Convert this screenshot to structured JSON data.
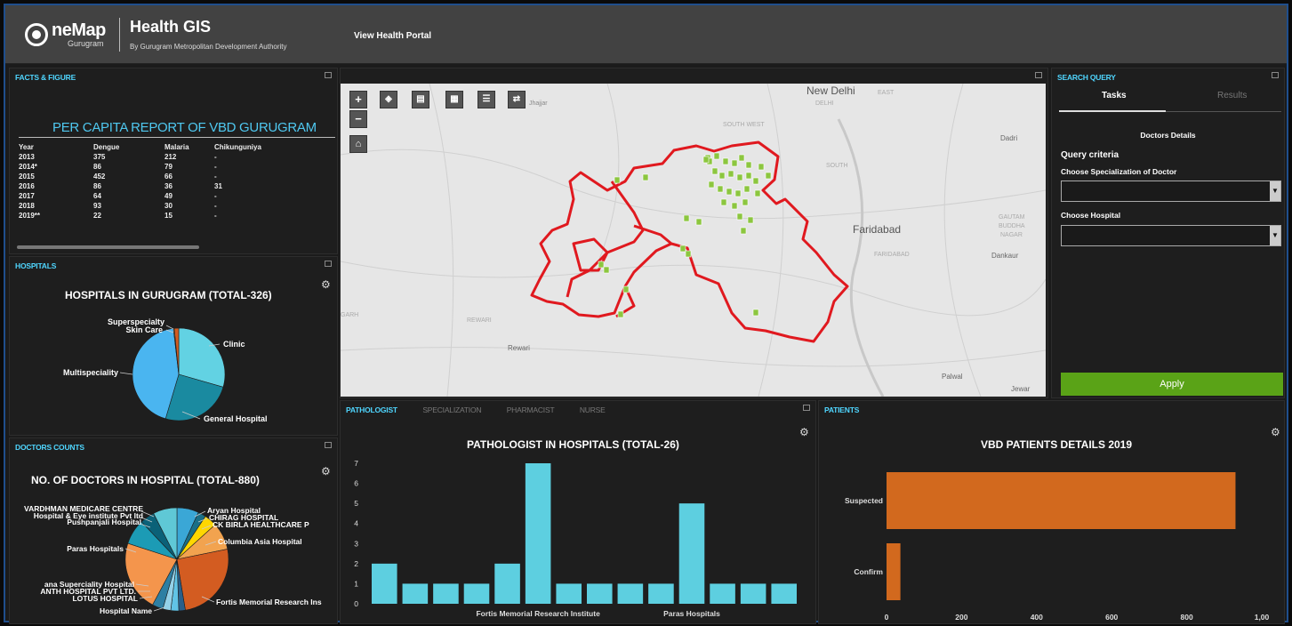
{
  "header": {
    "logo_name": "neMap",
    "logo_sub": "Gurugram",
    "title": "Health GIS",
    "subtitle": "By Gurugram Metropolitan Development Authority",
    "portal_link": "View Health Portal"
  },
  "facts": {
    "panel_title": "FACTS & FIGURE",
    "heading": "PER CAPITA REPORT OF VBD GURUGRAM",
    "columns": [
      "Year",
      "Dengue",
      "Malaria",
      "Chikunguniya"
    ],
    "rows": [
      [
        "2013",
        "375",
        "212",
        "-"
      ],
      [
        "2014*",
        "86",
        "79",
        "-"
      ],
      [
        "2015",
        "452",
        "66",
        "-"
      ],
      [
        "2016",
        "86",
        "36",
        "31"
      ],
      [
        "2017",
        "64",
        "49",
        "-"
      ],
      [
        "2018",
        "93",
        "30",
        "-"
      ],
      [
        "2019**",
        "22",
        "15",
        "-"
      ]
    ]
  },
  "hospitals": {
    "panel_title": "HOSPITALS",
    "chart_title": "HOSPITALS IN GURUGRAM (TOTAL-326)",
    "labels": {
      "superspecialty": "Superspecialty",
      "skin_care": "Skin Care",
      "clinic": "Clinic",
      "multispeciality": "Multispeciality",
      "general_hospital": "General Hospital"
    }
  },
  "doctors": {
    "panel_title": "DOCTORS COUNTS",
    "chart_title": "NO. OF DOCTORS IN HOSPITAL (TOTAL-880)",
    "labels": {
      "vardhman": "VARDHMAN MEDICARE CENTRE",
      "eye": "Hospital & Eye institute Pvt ltd",
      "pushpanjali": "Pushpanjali Hospital",
      "paras": "Paras Hospitals",
      "rana": "ana Superciality Hospital",
      "anth": "ANTH HOSPITAL PVT LTD.",
      "lotus": "LOTUS HOSPITAL",
      "hospital_name": "Hospital Name",
      "aryan": "Aryan Hospital",
      "chirag": "CHIRAG HOSPITAL",
      "ckbirla": "CK BIRLA HEALTHCARE P",
      "columbia": "Columbia Asia Hospital",
      "fortis": "Fortis Memorial Research Ins"
    }
  },
  "map": {
    "place_labels": {
      "new_delhi": "New Delhi",
      "east": "EAST",
      "delhi": "DELHI",
      "southwest": "SOUTH WEST",
      "south": "SOUTH",
      "dadri": "Dadri",
      "faridabad": "Faridabad",
      "faridabad_small": "FARIDABAD",
      "gautam": "GAUTAM",
      "buddha": "BUDDHA",
      "nagar": "NAGAR",
      "dankaur": "Dankaur",
      "rewari_caps": "REWARI",
      "rewari": "Rewari",
      "garh": "GARH",
      "palwal": "Palwal",
      "jewar": "Jewar",
      "jhajjar": "Jhajjar"
    },
    "zoom_in": "+",
    "zoom_out": "−"
  },
  "search": {
    "panel_title": "SEARCH QUERY",
    "tab_tasks": "Tasks",
    "tab_results": "Results",
    "section": "Doctors Details",
    "criteria": "Query criteria",
    "label_specialization": "Choose Specialization of Doctor",
    "label_hospital": "Choose Hospital",
    "specialization_value": "",
    "hospital_value": "",
    "apply": "Apply"
  },
  "staff": {
    "tabs": [
      "PATHOLOGIST",
      "SPECIALIZATION",
      "PHARMACIST",
      "NURSE"
    ],
    "chart_title": "PATHOLOGIST IN HOSPITALS (TOTAL-26)"
  },
  "patients": {
    "panel_title": "PATIENTS",
    "chart_title": "VBD PATIENTS DETAILS 2019"
  },
  "colors": {
    "accent": "#4fd6ff",
    "apply_green": "#5aa317",
    "bar_cyan": "#5dcfe0",
    "bar_orange": "#d2691e",
    "boundary_red": "#e0191f",
    "hospital_green": "#8cc63f"
  },
  "chart_data": [
    {
      "type": "pie",
      "categories": [
        "Clinic",
        "General Hospital",
        "Multispeciality",
        "Skin Care",
        "Superspecialty"
      ],
      "values": [
        96,
        82,
        142,
        1,
        5
      ],
      "title": "HOSPITALS IN GURUGRAM (TOTAL-326)"
    },
    {
      "type": "pie",
      "categories": [
        "Aryan Hospital",
        "CHIRAG HOSPITAL",
        "CK BIRLA HEALTHCARE P",
        "Columbia Asia Hospital",
        "Fortis Memorial Research Ins",
        "Hospital Name",
        "LOTUS HOSPITAL",
        "ANTH HOSPITAL PVT LTD.",
        "ana Superciality Hospital",
        "Paras Hospitals",
        "Pushpanjali Hospital",
        "Hospital & Eye institute Pvt ltd",
        "VARDHMAN MEDICARE CENTRE"
      ],
      "values": [
        60,
        22,
        35,
        75,
        225,
        18,
        22,
        22,
        30,
        195,
        70,
        40,
        66
      ],
      "title": "NO. OF DOCTORS IN HOSPITAL (TOTAL-880)"
    },
    {
      "type": "bar",
      "title": "PATHOLOGIST IN HOSPITALS (TOTAL-26)",
      "categories": [
        "",
        "",
        "",
        "",
        "",
        "Fortis Memorial Research Institute",
        "",
        "",
        "",
        "",
        "Paras Hospitals",
        "",
        "",
        ""
      ],
      "values": [
        2,
        1,
        1,
        1,
        2,
        7,
        1,
        1,
        1,
        1,
        5,
        1,
        1,
        1
      ],
      "ylim": [
        0,
        7
      ],
      "yticks": [
        0,
        1,
        2,
        3,
        4,
        5,
        6,
        7
      ]
    },
    {
      "type": "bar",
      "orientation": "horizontal",
      "title": "VBD PATIENTS DETAILS 2019",
      "categories": [
        "Suspected",
        "Confirm"
      ],
      "values": [
        930,
        37
      ],
      "xlim": [
        0,
        1000
      ],
      "xticks": [
        "0",
        "200",
        "400",
        "600",
        "800",
        "1,00"
      ]
    }
  ]
}
